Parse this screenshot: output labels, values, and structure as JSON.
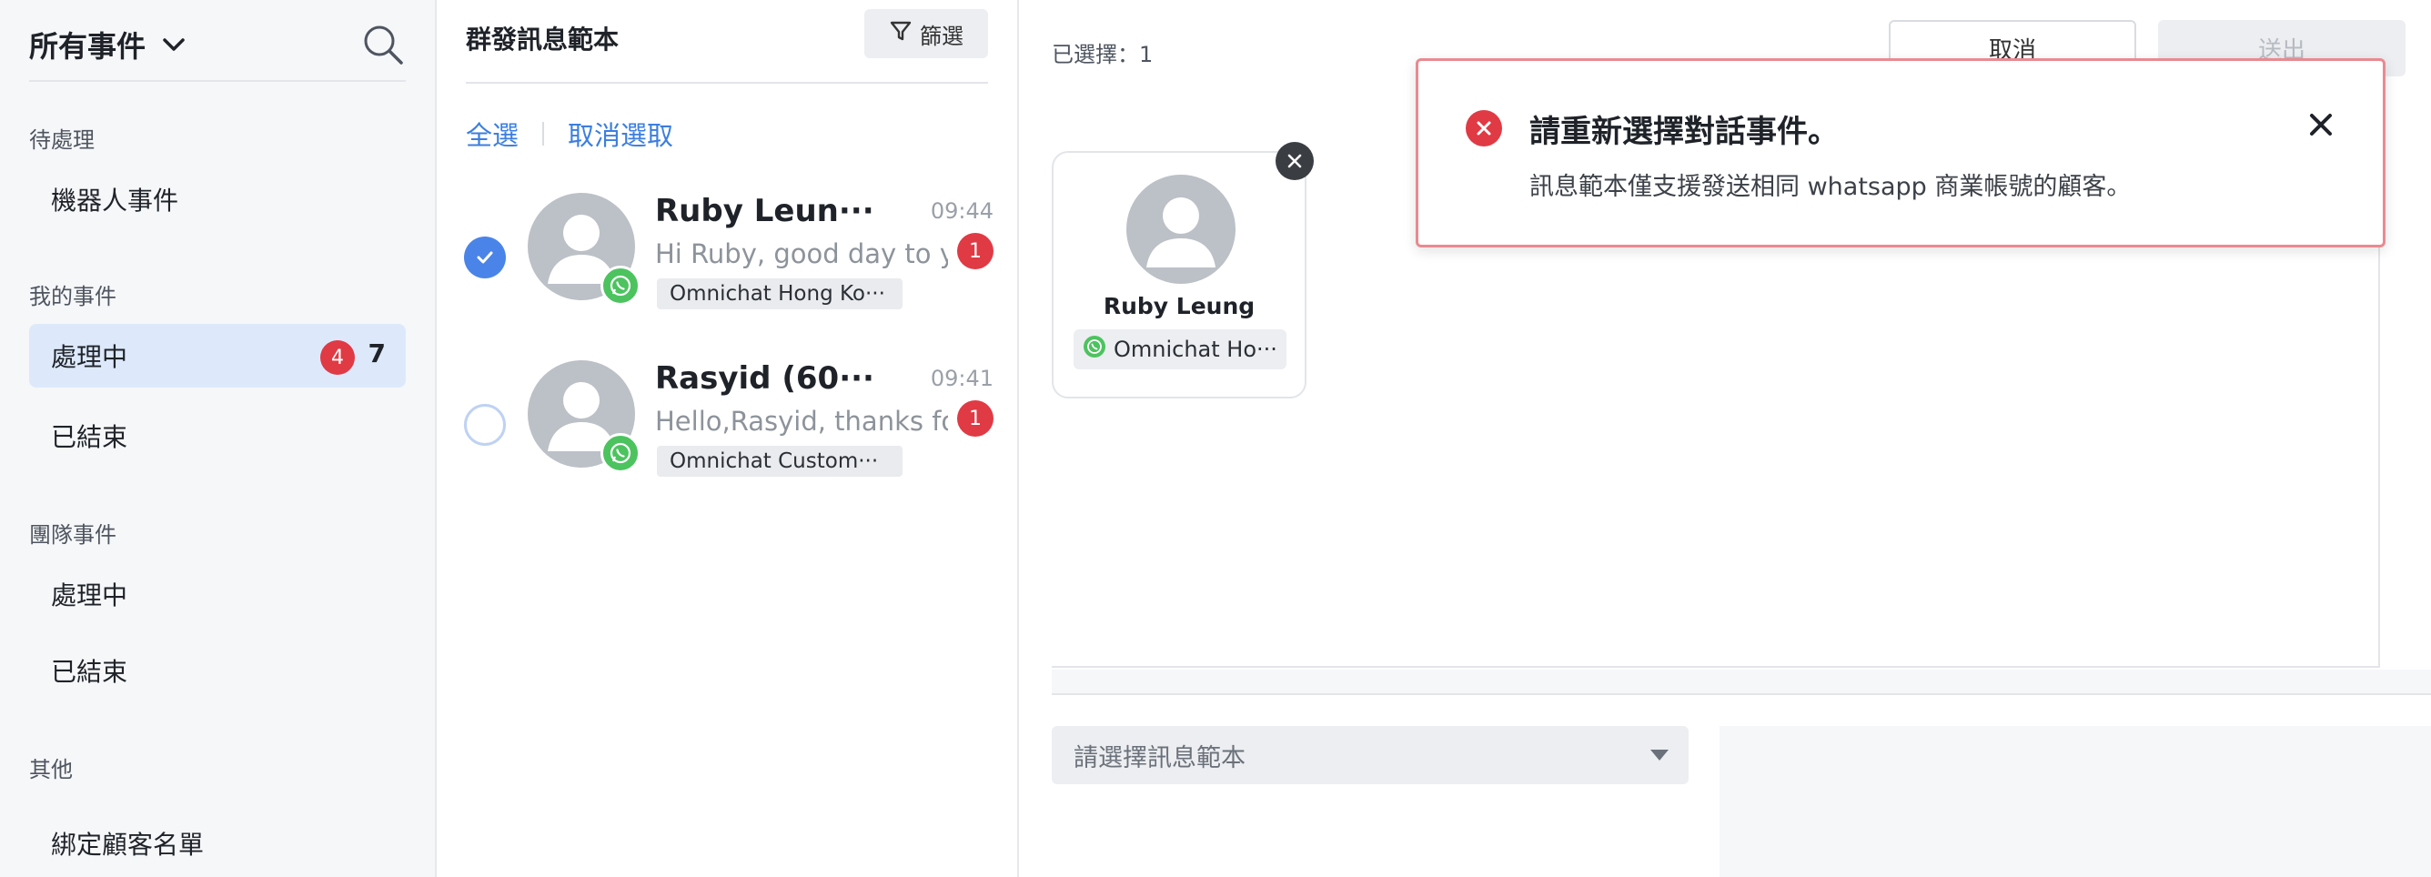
{
  "sidebar": {
    "title": "所有事件",
    "sections": [
      {
        "label": "待處理",
        "items": [
          {
            "label": "機器人事件"
          }
        ]
      },
      {
        "label": "我的事件",
        "items": [
          {
            "label": "處理中",
            "badge": "4",
            "count": "7",
            "active": true
          },
          {
            "label": "已結束"
          }
        ]
      },
      {
        "label": "團隊事件",
        "items": [
          {
            "label": "處理中"
          },
          {
            "label": "已結束"
          }
        ]
      },
      {
        "label": "其他",
        "items": [
          {
            "label": "綁定顧客名單"
          }
        ]
      }
    ]
  },
  "list": {
    "title": "群發訊息範本",
    "filter_label": "篩選",
    "select_all": "全選",
    "deselect": "取消選取",
    "conversations": [
      {
        "name": "Ruby Leun···",
        "time": "09:44",
        "preview": "Hi Ruby, good day to y···",
        "unread": "1",
        "channel": "Omnichat Hong Ko···",
        "selected": true
      },
      {
        "name": "Rasyid (60···",
        "time": "09:41",
        "preview": "Hello,Rasyid, thanks fo···",
        "unread": "1",
        "channel": "Omnichat Custom···",
        "selected": false
      }
    ]
  },
  "right": {
    "selected_text": "已選擇：1",
    "cancel_label": "取消",
    "send_label": "送出",
    "recipient": {
      "name": "Ruby Leung",
      "channel": "Omnichat Ho···"
    },
    "template_placeholder": "請選擇訊息範本"
  },
  "toast": {
    "title": "請重新選擇對話事件。",
    "message": "訊息範本僅支援發送相同 whatsapp 商業帳號的顧客。"
  },
  "colors": {
    "accent": "#3c7ee0",
    "danger": "#e03a45",
    "whatsapp": "#4cc35f",
    "active_bg": "#dde9fb"
  }
}
